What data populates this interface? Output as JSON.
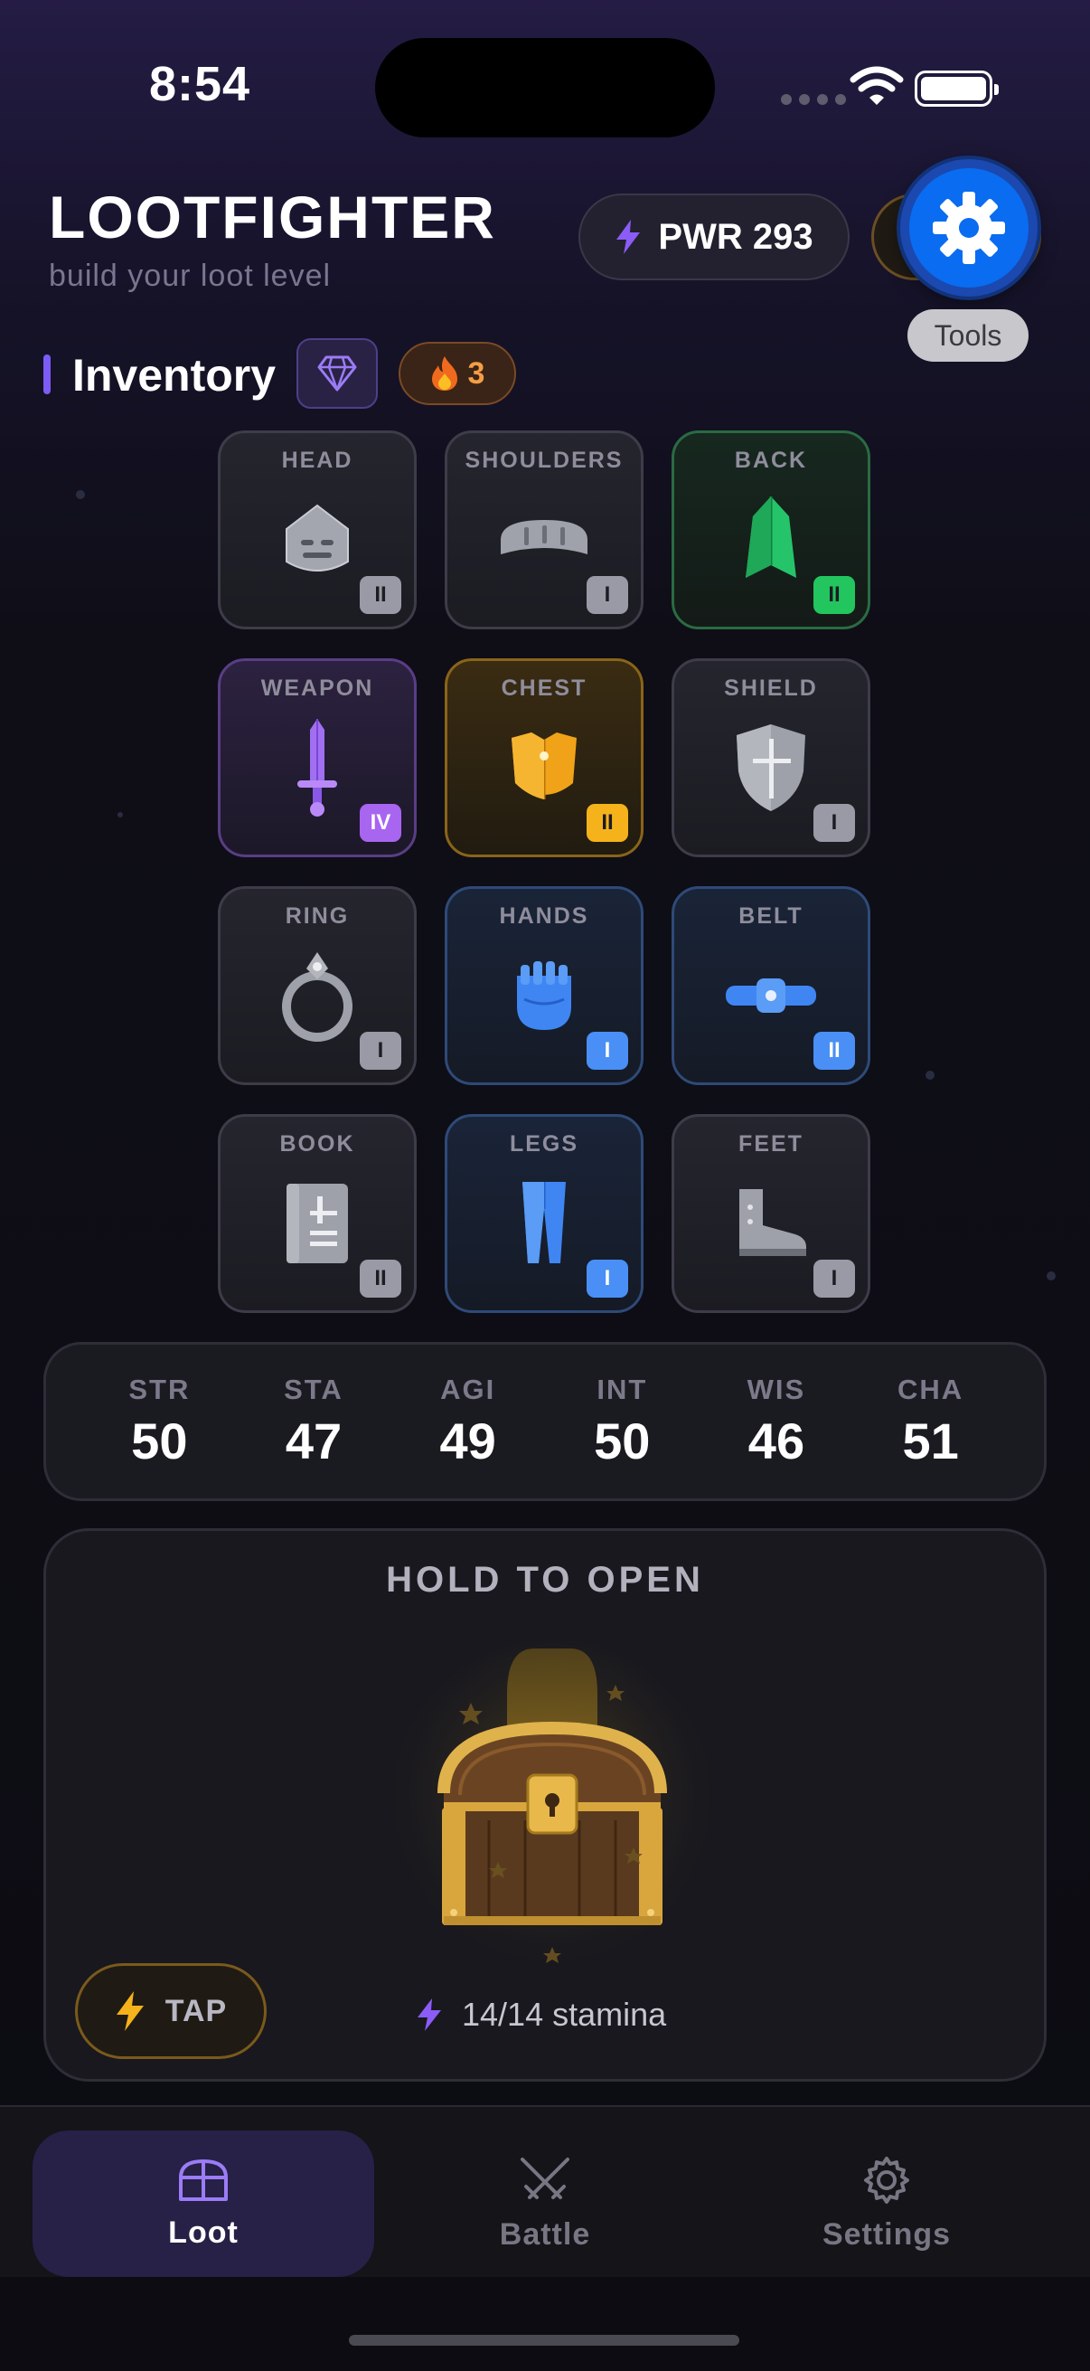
{
  "status_bar": {
    "time": "8:54"
  },
  "header": {
    "title": "LOOTFIGHTER",
    "subtitle": "build your loot level",
    "power_label": "PWR 293",
    "tools_label": "Tools"
  },
  "inventory": {
    "title": "Inventory",
    "streak_count": "3",
    "slots": [
      {
        "label": "HEAD",
        "tier": "II",
        "rarity": "gray"
      },
      {
        "label": "SHOULDERS",
        "tier": "I",
        "rarity": "gray"
      },
      {
        "label": "BACK",
        "tier": "II",
        "rarity": "green"
      },
      {
        "label": "WEAPON",
        "tier": "IV",
        "rarity": "purple"
      },
      {
        "label": "CHEST",
        "tier": "II",
        "rarity": "gold"
      },
      {
        "label": "SHIELD",
        "tier": "I",
        "rarity": "gray"
      },
      {
        "label": "RING",
        "tier": "I",
        "rarity": "gray"
      },
      {
        "label": "HANDS",
        "tier": "I",
        "rarity": "blue"
      },
      {
        "label": "BELT",
        "tier": "II",
        "rarity": "blue"
      },
      {
        "label": "BOOK",
        "tier": "II",
        "rarity": "gray"
      },
      {
        "label": "LEGS",
        "tier": "I",
        "rarity": "blue"
      },
      {
        "label": "FEET",
        "tier": "I",
        "rarity": "gray"
      }
    ]
  },
  "stats": [
    {
      "name": "STR",
      "value": "50"
    },
    {
      "name": "STA",
      "value": "47"
    },
    {
      "name": "AGI",
      "value": "49"
    },
    {
      "name": "INT",
      "value": "50"
    },
    {
      "name": "WIS",
      "value": "46"
    },
    {
      "name": "CHA",
      "value": "51"
    }
  ],
  "chest": {
    "title": "HOLD TO OPEN",
    "tap_label": "TAP",
    "stamina": "14/14 stamina"
  },
  "tabs": [
    {
      "label": "Loot",
      "icon": "chest-icon",
      "active": true
    },
    {
      "label": "Battle",
      "icon": "crossed-swords-icon",
      "active": false
    },
    {
      "label": "Settings",
      "icon": "gear-icon",
      "active": false
    }
  ],
  "colors": {
    "accent": "#7c5cf5",
    "fab": "#0a6cf0",
    "green": "#22c55e",
    "purple": "#a865f0",
    "gold": "#f5b21b",
    "blue": "#4a8ff5"
  }
}
